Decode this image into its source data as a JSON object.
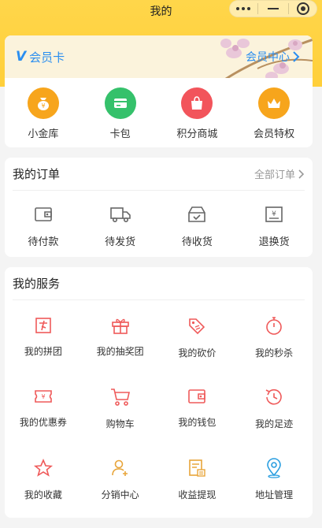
{
  "nav": {
    "title": "我的"
  },
  "member": {
    "label": "会员卡",
    "center_link": "会员中心"
  },
  "quick": [
    {
      "label": "小金库",
      "icon": "coin-bag-icon",
      "color": "#f7a51c"
    },
    {
      "label": "卡包",
      "icon": "card-icon",
      "color": "#35c16b"
    },
    {
      "label": "积分商城",
      "icon": "shopping-bag-icon",
      "color": "#f2545b"
    },
    {
      "label": "会员特权",
      "icon": "crown-icon",
      "color": "#f7a51c"
    }
  ],
  "orders": {
    "title": "我的订单",
    "all_link": "全部订单",
    "items": [
      {
        "label": "待付款",
        "icon": "wallet-icon"
      },
      {
        "label": "待发货",
        "icon": "truck-icon"
      },
      {
        "label": "待收货",
        "icon": "inbox-check-icon"
      },
      {
        "label": "退换货",
        "icon": "refund-icon"
      }
    ]
  },
  "services": {
    "title": "我的服务",
    "items": [
      {
        "label": "我的拼团",
        "icon": "group-buy-icon",
        "color": "#ef5a5a"
      },
      {
        "label": "我的抽奖团",
        "icon": "gift-icon",
        "color": "#ef5a5a"
      },
      {
        "label": "我的砍价",
        "icon": "price-tag-icon",
        "color": "#ef5a5a"
      },
      {
        "label": "我的秒杀",
        "icon": "stopwatch-icon",
        "color": "#ef5a5a"
      },
      {
        "label": "我的优惠券",
        "icon": "coupon-icon",
        "color": "#ef5a5a"
      },
      {
        "label": "购物车",
        "icon": "cart-icon",
        "color": "#ef5a5a"
      },
      {
        "label": "我的钱包",
        "icon": "wallet-icon",
        "color": "#ef5a5a"
      },
      {
        "label": "我的足迹",
        "icon": "history-icon",
        "color": "#ef5a5a"
      },
      {
        "label": "我的收藏",
        "icon": "star-icon",
        "color": "#ef5a5a"
      },
      {
        "label": "分销中心",
        "icon": "user-add-icon",
        "color": "#e8a53a"
      },
      {
        "label": "收益提现",
        "icon": "withdraw-icon",
        "color": "#e8a53a"
      },
      {
        "label": "地址管理",
        "icon": "location-icon",
        "color": "#2a9ee0"
      }
    ]
  }
}
